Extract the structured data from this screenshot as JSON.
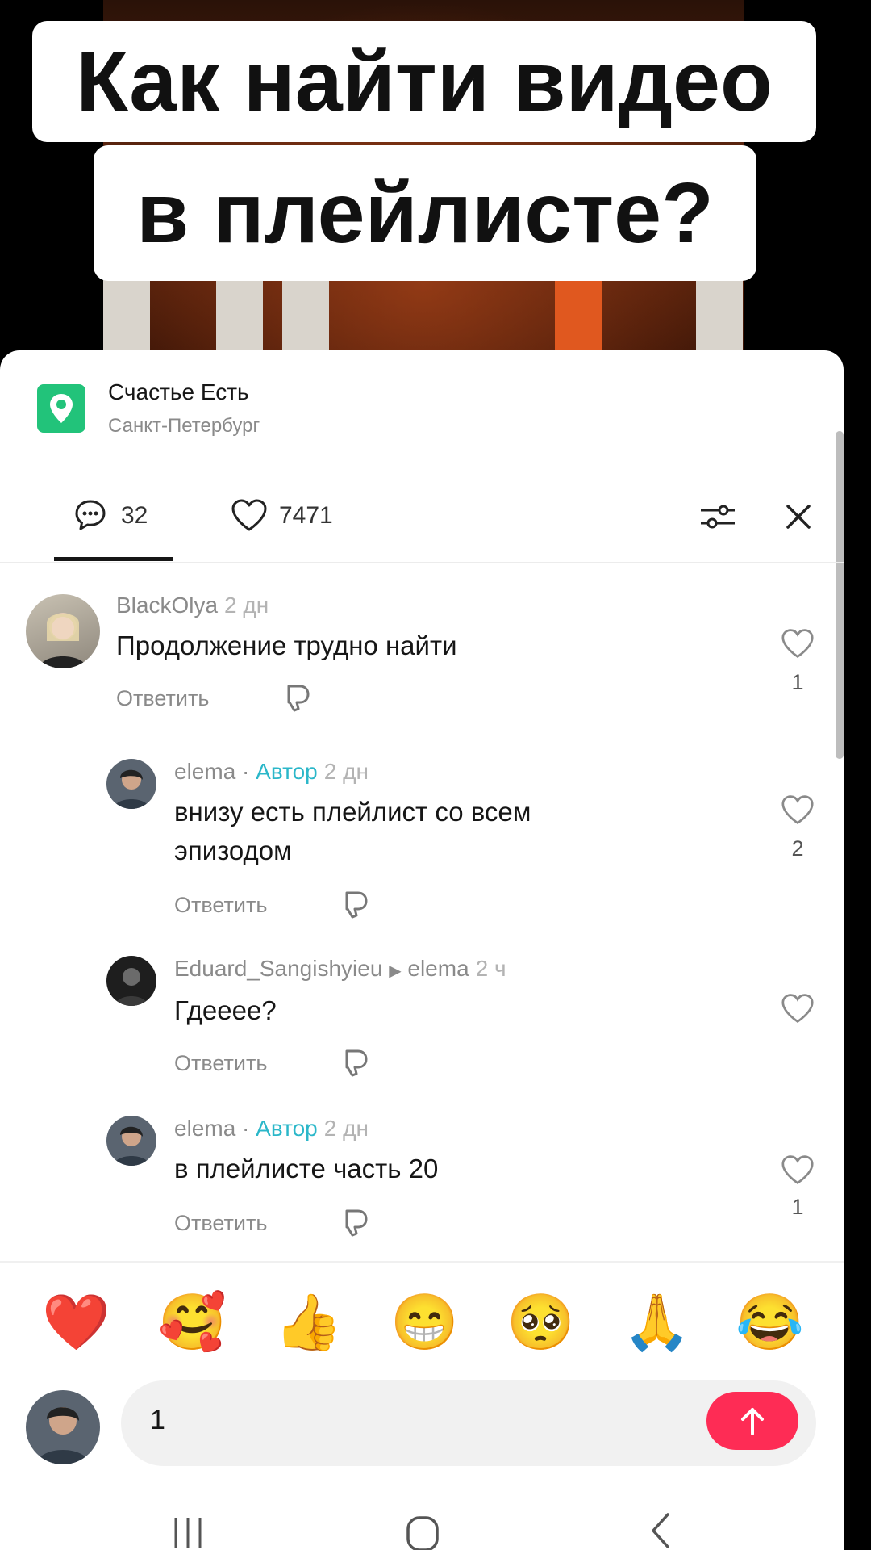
{
  "caption": {
    "line1": "Как найти видео",
    "line2": "в плейлисте?"
  },
  "place": {
    "name": "Счастье Есть",
    "city": "Санкт-Петербург"
  },
  "tabs": {
    "comments_count": "32",
    "likes_count": "7471"
  },
  "comments": [
    {
      "user": "BlackOlya",
      "author_badge": "",
      "reply_to": "",
      "time": "2 дн",
      "text": "Продолжение трудно найти",
      "reply_label": "Ответить",
      "likes": "1"
    },
    {
      "user": "elema",
      "author_badge": "Автор",
      "reply_to": "",
      "time": "2 дн",
      "text": "внизу есть плейлист со всем эпизодом",
      "reply_label": "Ответить",
      "likes": "2"
    },
    {
      "user": "Eduard_Sangishyieu",
      "author_badge": "",
      "reply_to": "elema",
      "time": "2 ч",
      "text": "Гдееее?",
      "reply_label": "Ответить",
      "likes": ""
    },
    {
      "user": "elema",
      "author_badge": "Автор",
      "reply_to": "",
      "time": "2 дн",
      "text": "в плейлисте часть 20",
      "reply_label": "Ответить",
      "likes": "1"
    }
  ],
  "emoji_bar": [
    "❤️",
    "🥰",
    "👍",
    "😁",
    "🥺",
    "🙏",
    "😂"
  ],
  "input": {
    "value": "1"
  },
  "colors": {
    "accent": "#fe2c55",
    "author": "#2bb7c9",
    "place_icon": "#22c37a"
  }
}
